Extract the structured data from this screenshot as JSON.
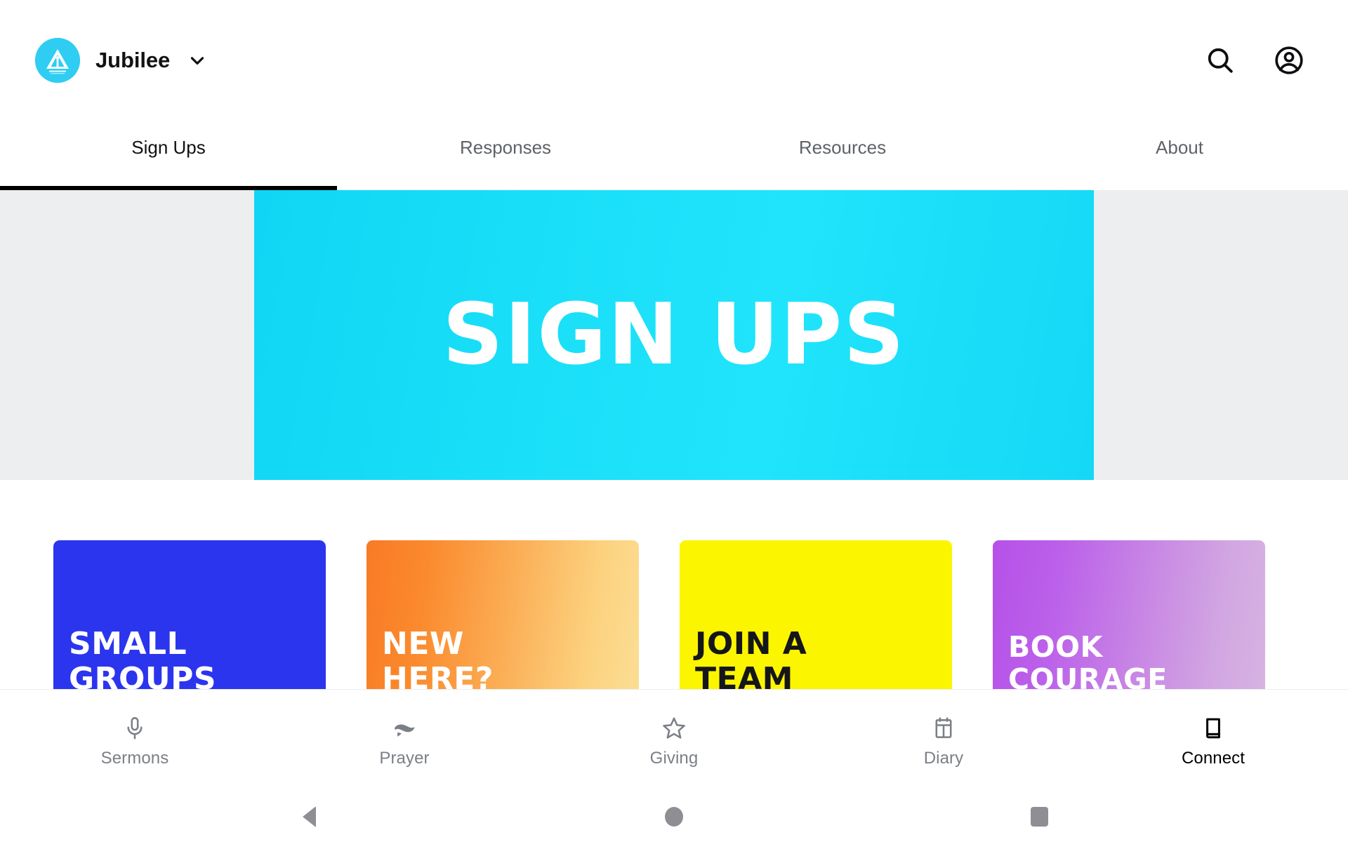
{
  "appbar": {
    "brand_name": "Jubilee",
    "brand_logo_icon": "jubilee-triangle-logo",
    "brand_caret_icon": "chevron-down-icon",
    "search_icon": "search-icon",
    "account_icon": "account-circle-icon"
  },
  "tabs": [
    {
      "label": "Sign Ups",
      "active": true
    },
    {
      "label": "Responses",
      "active": false
    },
    {
      "label": "Resources",
      "active": false
    },
    {
      "label": "About",
      "active": false
    }
  ],
  "hero": {
    "title": "SIGN UPS",
    "background_color": "#18DCF8",
    "page_background_color": "#ECEEEF"
  },
  "cards": [
    {
      "title": "SMALL\nGROUPS",
      "color": "#2B35EE",
      "text_color": "#FFFFFF"
    },
    {
      "title": "NEW\nHERE?",
      "color": "#F97A25",
      "text_color": "#FFFFFF"
    },
    {
      "title": "JOIN A\nTEAM",
      "color": "#FBF500",
      "text_color": "#15161A"
    },
    {
      "title": "BOOK\nCOURAGE",
      "color": "#B551E8",
      "text_color": "#FFFFFF"
    }
  ],
  "bottom_nav": [
    {
      "label": "Sermons",
      "icon": "microphone-icon",
      "active": false
    },
    {
      "label": "Prayer",
      "icon": "praying-hands-icon",
      "active": false
    },
    {
      "label": "Giving",
      "icon": "star-outline-icon",
      "active": false
    },
    {
      "label": "Diary",
      "icon": "calendar-icon",
      "active": false
    },
    {
      "label": "Connect",
      "icon": "book-icon",
      "active": true
    }
  ],
  "system_nav": {
    "back_icon": "android-back-icon",
    "home_icon": "android-home-icon",
    "recents_icon": "android-recents-icon"
  }
}
